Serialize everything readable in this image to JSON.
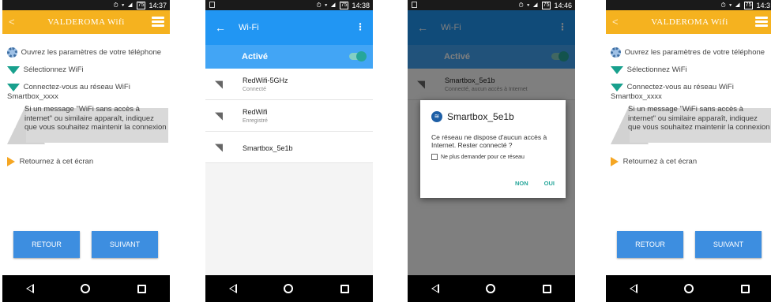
{
  "status_bar": {
    "icons": "⏱ ▾ ◢",
    "battery": "75",
    "time_1": "14:37",
    "time_2": "14:38",
    "time_3": "14:46",
    "time_4": "14:3"
  },
  "valderoma": {
    "title": "VALDEROMA Wifi",
    "back_glyph": "<",
    "steps": [
      "Ouvrez les paramètres de votre téléphone",
      "Sélectionnez WiFi",
      "Connectez-vous au réseau WiFi Smartbox_xxxx",
      "Si un message \"WiFi sans accès à internet\" ou similaire apparaît, indiquez que vous souhaitez maintenir la connexion",
      "Retournez à cet écran"
    ],
    "warning_glyph": "!",
    "back_button": "RETOUR",
    "next_button": "SUIVANT"
  },
  "wifi_settings": {
    "back_glyph": "←",
    "title": "Wi-Fi",
    "more_glyph": "⋮",
    "toggle_label": "Activé",
    "signal_glyph": "◥",
    "networks": [
      {
        "name": "RedWifi-5GHz",
        "status": "Connecté"
      },
      {
        "name": "RedWifi",
        "status": "Enregistré"
      },
      {
        "name": "Smartbox_5e1b",
        "status": ""
      }
    ]
  },
  "dialog_screen": {
    "bg_network_name": "Smartbox_5e1b",
    "bg_network_status": "Connecté, aucun accès à Internet",
    "dialog_title": "Smartbox_5e1b",
    "dialog_icon": "≋",
    "dialog_message": "Ce réseau ne dispose d'aucun accès à Internet. Rester connecté ?",
    "checkbox_label": "Ne plus demander pour ce réseau",
    "no_button": "NON",
    "yes_button": "OUI"
  },
  "colors": {
    "valderoma_header": "#f5b21f",
    "action_blue": "#3d8ee0",
    "android_blue": "#2196f3",
    "teal": "#26a69a"
  }
}
